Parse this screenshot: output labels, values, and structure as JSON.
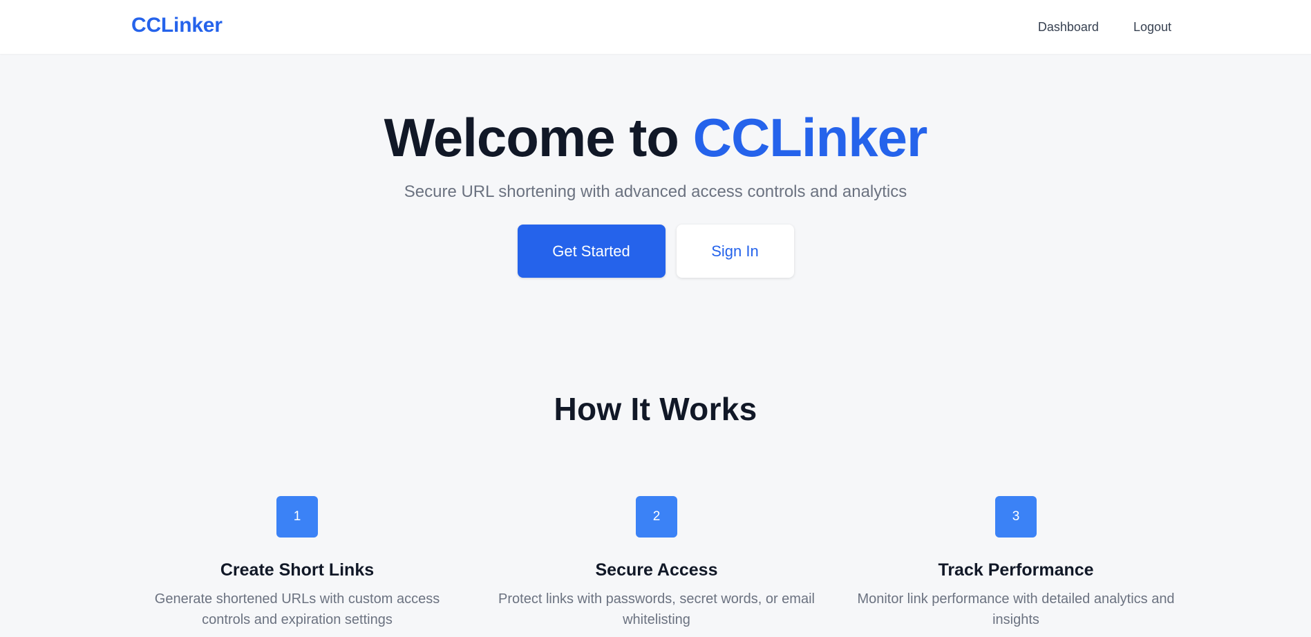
{
  "nav": {
    "brand": "CCLinker",
    "links": [
      {
        "label": "Dashboard"
      },
      {
        "label": "Logout"
      }
    ]
  },
  "hero": {
    "title_prefix": "Welcome to ",
    "title_brand": "CCLinker",
    "subtitle": "Secure URL shortening with advanced access controls and analytics",
    "primary_button": "Get Started",
    "secondary_button": "Sign In"
  },
  "how_it_works": {
    "title": "How It Works",
    "steps": [
      {
        "number": "1",
        "title": "Create Short Links",
        "description": "Generate shortened URLs with custom access controls and expiration settings"
      },
      {
        "number": "2",
        "title": "Secure Access",
        "description": "Protect links with passwords, secret words, or email whitelisting"
      },
      {
        "number": "3",
        "title": "Track Performance",
        "description": "Monitor link performance with detailed analytics and insights"
      }
    ]
  },
  "colors": {
    "brand": "#2563eb",
    "badge": "#3b82f6",
    "page_background": "#f6f7f9"
  }
}
